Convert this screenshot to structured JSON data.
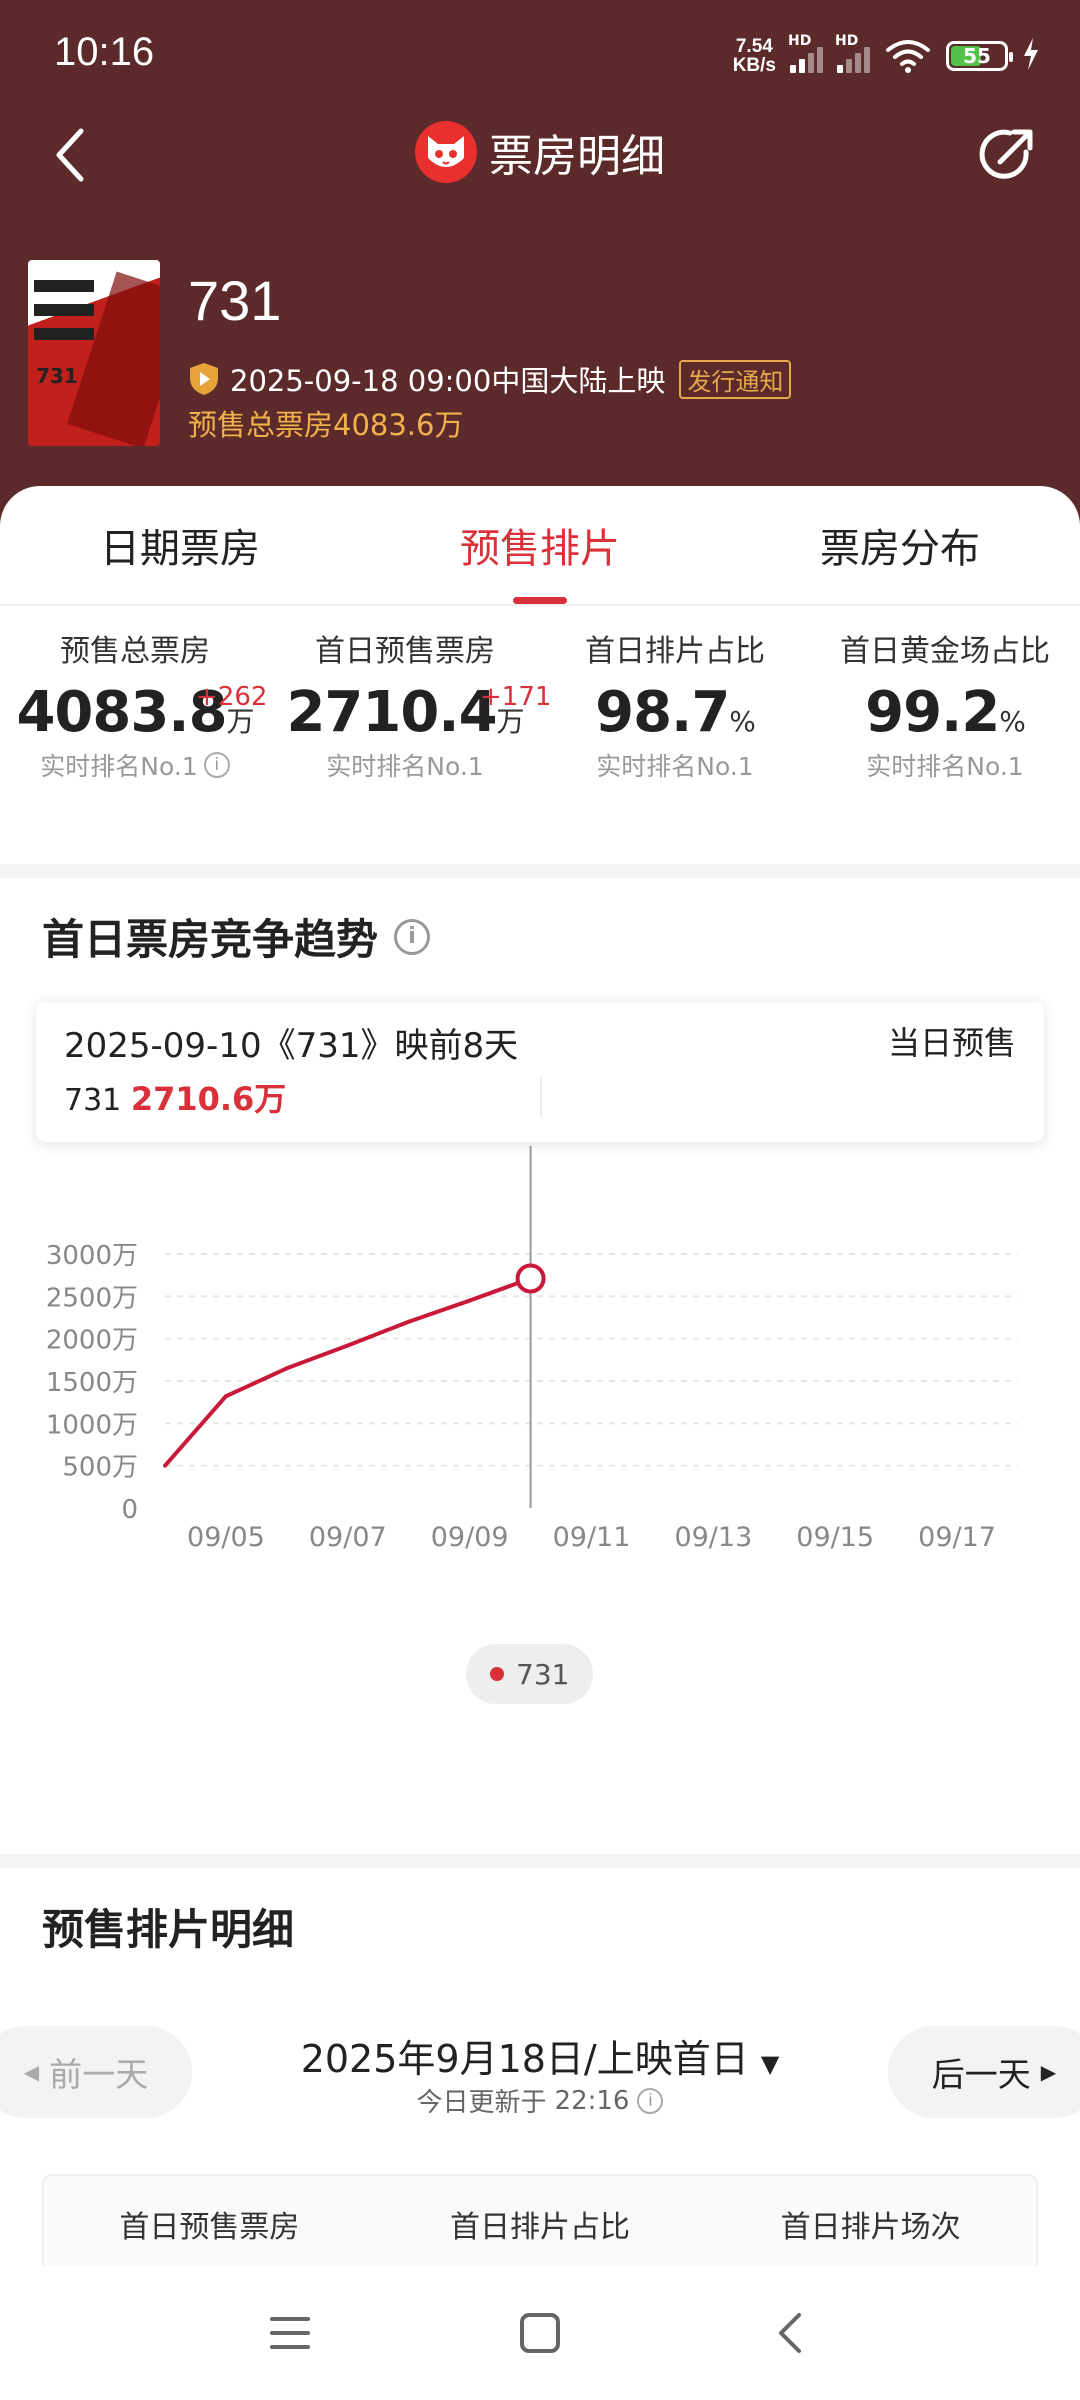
{
  "status_bar": {
    "time": "10:16",
    "net_speed_value": "7.54",
    "net_speed_unit": "KB/s",
    "hd_label_1": "HD",
    "hd_label_2": "HD",
    "battery": "55"
  },
  "nav": {
    "title": "票房明细",
    "back_icon": "back-arrow-icon",
    "share_icon": "share-icon"
  },
  "movie": {
    "title": "731",
    "release_text": "2025-09-18 09:00中国大陆上映",
    "notify_badge": "发行通知",
    "presale_total_text": "预售总票房4083.6万",
    "poster_number": "731"
  },
  "tabs": [
    {
      "label": "日期票房",
      "active": false
    },
    {
      "label": "预售排片",
      "active": true
    },
    {
      "label": "票房分布",
      "active": false
    }
  ],
  "stats": [
    {
      "label": "预售总票房",
      "value": "4083.8",
      "unit": "万",
      "delta": "+262",
      "rank": "实时排名No.1"
    },
    {
      "label": "首日预售票房",
      "value": "2710.4",
      "unit": "万",
      "delta": "+171",
      "rank": "实时排名No.1"
    },
    {
      "label": "首日排片占比",
      "value": "98.7",
      "unit": "%",
      "delta": "",
      "rank": "实时排名No.1"
    },
    {
      "label": "首日黄金场占比",
      "value": "99.2",
      "unit": "%",
      "delta": "",
      "rank": "实时排名No.1"
    }
  ],
  "trend": {
    "title": "首日票房竞争趋势",
    "tooltip": {
      "date_text": "2025-09-10《731》映前8天",
      "right_text": "当日预售",
      "series_name": "731",
      "series_value": "2710.6万"
    }
  },
  "chart_data": {
    "type": "line",
    "title": "",
    "xlabel": "",
    "ylabel": "",
    "ylim": [
      0,
      3000
    ],
    "y_ticks": [
      "0",
      "500万",
      "1000万",
      "1500万",
      "2000万",
      "2500万",
      "3000万"
    ],
    "x_tick_labels": [
      "09/05",
      "09/07",
      "09/09",
      "09/11",
      "09/13",
      "09/15",
      "09/17"
    ],
    "x_range": [
      "09/04",
      "09/18"
    ],
    "grid": true,
    "legend": "bottom-center",
    "series": [
      {
        "name": "731",
        "color": "#c9193a",
        "x": [
          "09/04",
          "09/05",
          "09/06",
          "09/07",
          "09/08",
          "09/09",
          "09/10"
        ],
        "y": [
          500,
          1320,
          1650,
          1920,
          2200,
          2450,
          2710.6
        ]
      }
    ],
    "highlight": {
      "x": "09/10",
      "y": 2710.6
    }
  },
  "presale_detail": {
    "title": "预售排片明细",
    "prev_day": "前一天",
    "next_day": "后一天",
    "date": "2025年9月18日/上映首日",
    "update_prefix": "今日更新于",
    "update_time": "22:16",
    "columns": [
      "首日预售票房",
      "首日排片占比",
      "首日排片场次"
    ]
  },
  "colors": {
    "header_bg": "#5c2a2b",
    "accent_red": "#d9303a",
    "gold": "#f0b24a"
  }
}
